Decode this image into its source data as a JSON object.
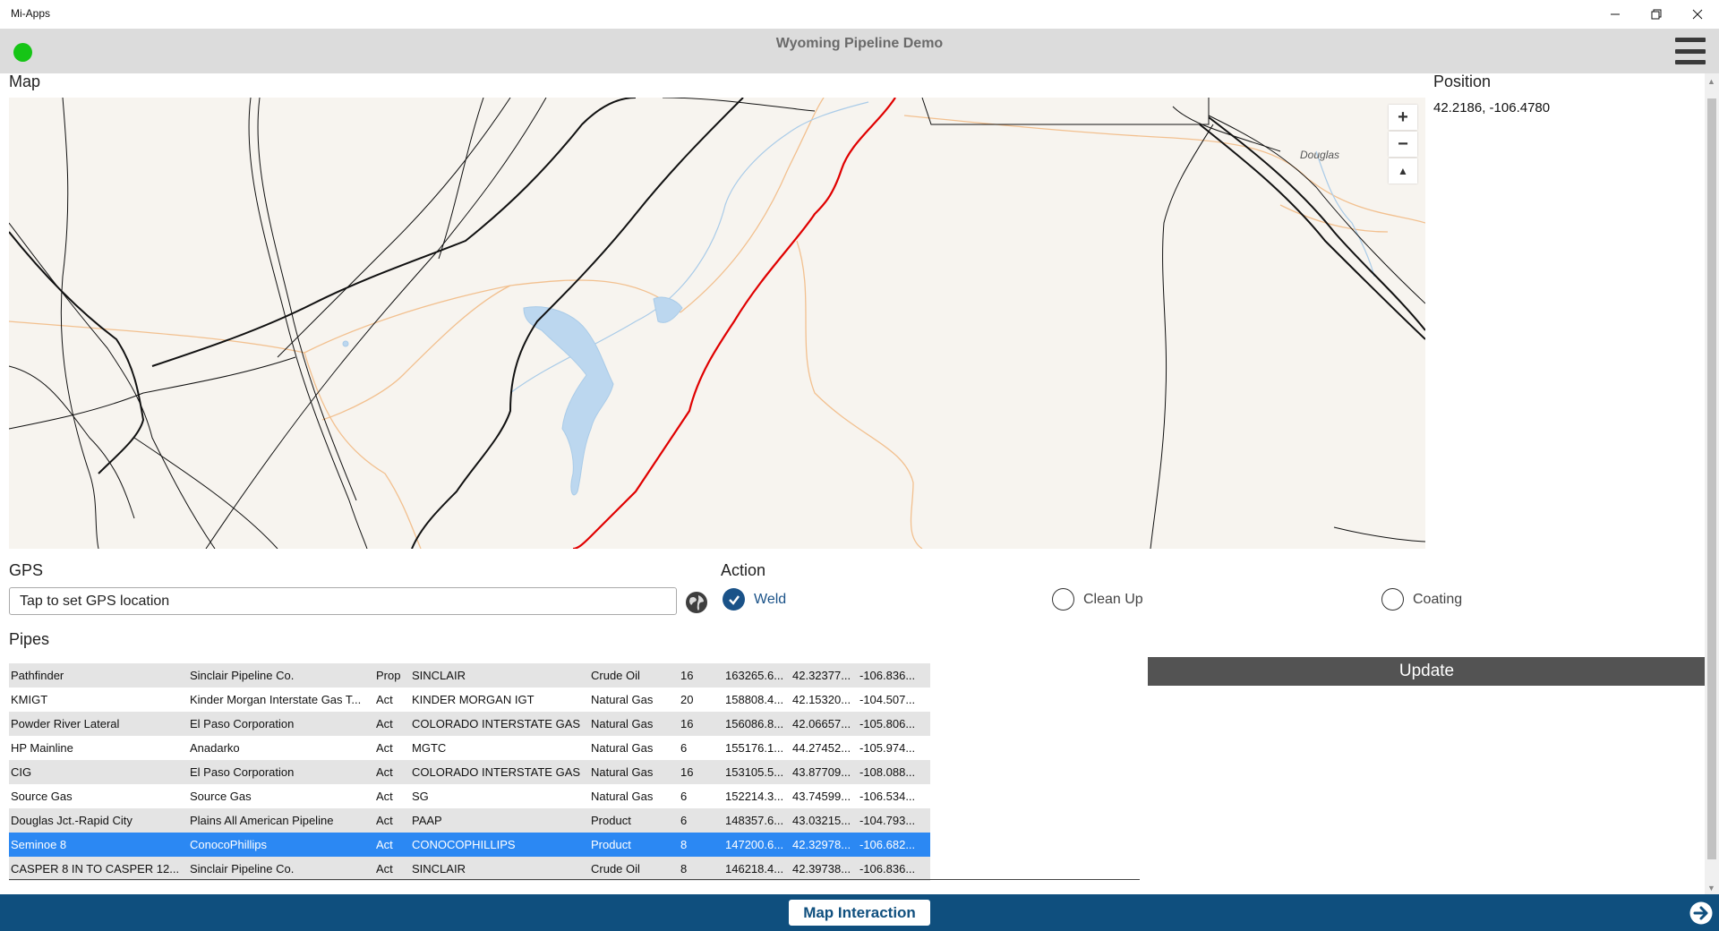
{
  "window": {
    "title": "Mi-Apps",
    "controls": [
      "minimize-icon",
      "restore-icon",
      "close-icon"
    ]
  },
  "header": {
    "title": "Wyoming Pipeline Demo",
    "status_color": "#16c516",
    "menu_icon": "hamburger-menu-icon"
  },
  "map": {
    "label": "Map",
    "zoom_in": "+",
    "zoom_out": "−",
    "north": "▲",
    "town_label": "Douglas",
    "highlight_color": "#e00000"
  },
  "position": {
    "label": "Position",
    "value": "42.2186, -106.4780"
  },
  "gps": {
    "label": "GPS",
    "placeholder": "Tap to set GPS location",
    "icon": "globe-icon"
  },
  "action": {
    "label": "Action",
    "options": [
      {
        "label": "Weld",
        "checked": true
      },
      {
        "label": "Clean Up",
        "checked": false
      },
      {
        "label": "Coating",
        "checked": false
      }
    ]
  },
  "pipes": {
    "label": "Pipes",
    "rows": [
      [
        "Pathfinder",
        "Sinclair Pipeline Co.",
        "Prop",
        "SINCLAIR",
        "Crude Oil",
        "16",
        "163265.6...",
        "42.32377...",
        "-106.836..."
      ],
      [
        "KMIGT",
        "Kinder Morgan Interstate Gas T...",
        "Act",
        "KINDER MORGAN IGT",
        "Natural Gas",
        "20",
        "158808.4...",
        "42.15320...",
        "-104.507..."
      ],
      [
        "Powder River Lateral",
        "El Paso Corporation",
        "Act",
        "COLORADO INTERSTATE GAS",
        "Natural Gas",
        "16",
        "156086.8...",
        "42.06657...",
        "-105.806..."
      ],
      [
        "HP Mainline",
        "Anadarko",
        "Act",
        "MGTC",
        "Natural Gas",
        "6",
        "155176.1...",
        "44.27452...",
        "-105.974..."
      ],
      [
        "CIG",
        "El Paso Corporation",
        "Act",
        "COLORADO INTERSTATE GAS",
        "Natural Gas",
        "16",
        "153105.5...",
        "43.87709...",
        "-108.088..."
      ],
      [
        "Source Gas",
        "Source Gas",
        "Act",
        "SG",
        "Natural Gas",
        "6",
        "152214.3...",
        "43.74599...",
        "-106.534..."
      ],
      [
        "Douglas Jct.-Rapid City",
        "Plains All American Pipeline",
        "Act",
        "PAAP",
        "Product",
        "6",
        "148357.6...",
        "43.03215...",
        "-104.793..."
      ],
      [
        "Seminoe 8",
        "ConocoPhillips",
        "Act",
        "CONOCOPHILLIPS",
        "Product",
        "8",
        "147200.6...",
        "42.32978...",
        "-106.682..."
      ],
      [
        "CASPER 8 IN TO CASPER 12...",
        "Sinclair Pipeline Co.",
        "Act",
        "SINCLAIR",
        "Crude Oil",
        "8",
        "146218.4...",
        "42.39738...",
        "-106.836..."
      ]
    ],
    "selected_index": 7,
    "selected_color": "#2b88f3"
  },
  "update": {
    "label": "Update"
  },
  "footer": {
    "button_label": "Map Interaction",
    "next_icon": "arrow-right-circle-icon",
    "color": "#0f4f7e"
  }
}
